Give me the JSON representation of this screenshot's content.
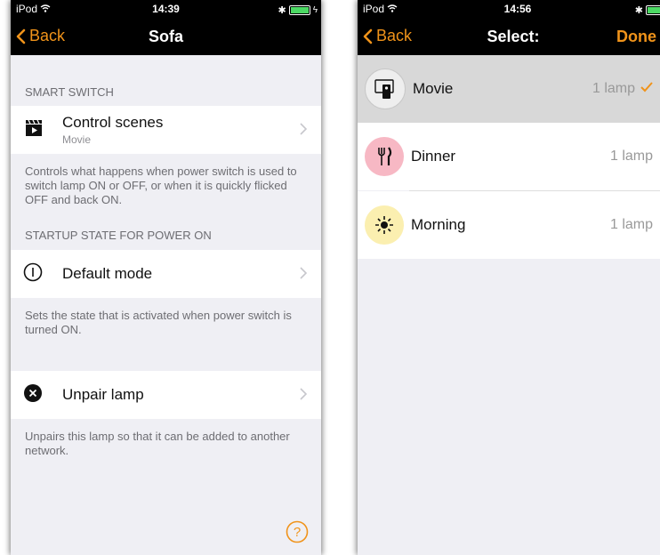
{
  "left": {
    "status": {
      "carrier": "iPod",
      "time": "14:39"
    },
    "nav": {
      "back_label": "Back",
      "title": "Sofa"
    },
    "sections": {
      "smart_switch_header": "SMART SWITCH",
      "control_scenes_title": "Control scenes",
      "control_scenes_subtitle": "Movie",
      "smart_switch_footer": "Controls what happens when power switch is used to switch lamp ON or OFF, or when it is quickly flicked OFF and back ON.",
      "startup_header": "STARTUP STATE FOR POWER ON",
      "default_mode_label": "Default mode",
      "startup_footer": "Sets the state that is activated when power switch is turned ON.",
      "unpair_label": "Unpair lamp",
      "unpair_footer": "Unpairs this lamp so that it can be added to another network."
    },
    "help_icon": "question-circle-icon"
  },
  "right": {
    "status": {
      "carrier": "iPod",
      "time": "14:56"
    },
    "nav": {
      "back_label": "Back",
      "title": "Select:",
      "done_label": "Done"
    },
    "scenes": [
      {
        "name": "Movie",
        "count": "1 lamp",
        "selected": true,
        "icon": "tv-remote-icon"
      },
      {
        "name": "Dinner",
        "count": "1 lamp",
        "selected": false,
        "icon": "fork-knife-icon"
      },
      {
        "name": "Morning",
        "count": "1 lamp",
        "selected": false,
        "icon": "sun-icon"
      }
    ]
  },
  "colors": {
    "accent": "#f0931a",
    "check": "#f0931a",
    "dinner_bg": "#f7b8c4",
    "morning_bg": "#fbefb0"
  }
}
